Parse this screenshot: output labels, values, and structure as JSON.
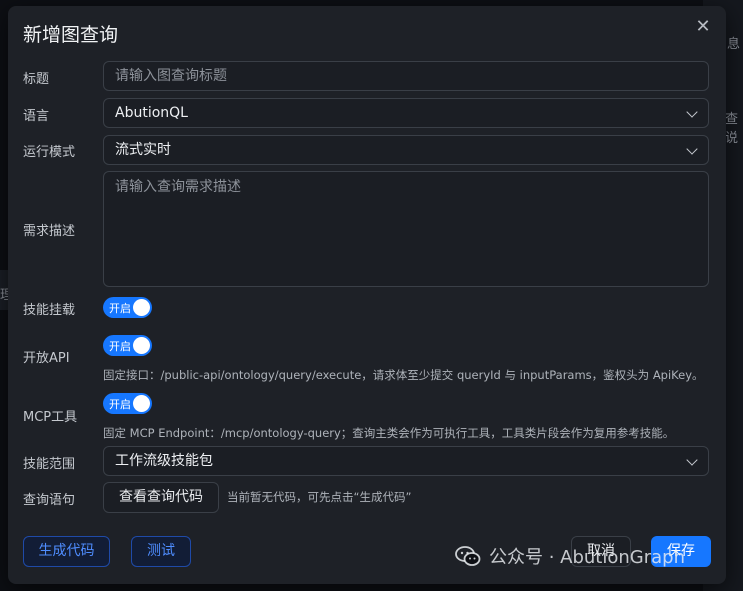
{
  "dialog": {
    "title": "新增图查询",
    "close_glyph": "✕"
  },
  "form": {
    "title_label": "标题",
    "title_placeholder": "请输入图查询标题",
    "language_label": "语言",
    "language_value": "AbutionQL",
    "mode_label": "运行模式",
    "mode_value": "流式实时",
    "desc_label": "需求描述",
    "desc_placeholder": "请输入查询需求描述",
    "skill_mount_label": "技能挂载",
    "skill_mount_toggle": "开启",
    "open_api_label": "开放API",
    "open_api_toggle": "开启",
    "open_api_hint": "固定接口：/public-api/ontology/query/execute，请求体至少提交 queryId 与 inputParams，鉴权头为 ApiKey。",
    "mcp_label": "MCP工具",
    "mcp_toggle": "开启",
    "mcp_hint": "固定 MCP Endpoint：/mcp/ontology-query；查询主类会作为可执行工具，工具类片段会作为复用参考技能。",
    "skill_scope_label": "技能范围",
    "skill_scope_value": "工作流级技能包",
    "query_label": "查询语句",
    "view_code_button": "查看查询代码",
    "query_hint": "当前暂无代码，可先点击“生成代码”"
  },
  "footer": {
    "generate_button": "生成代码",
    "test_button": "测试",
    "cancel_button": "取消",
    "save_button": "保存"
  },
  "background": {
    "right_text_1": "息",
    "right_text_2": "查说",
    "left_text": "理"
  },
  "watermark": {
    "text": "公众号 · AbutionGraph",
    "icon": "wechat-icon"
  },
  "colors": {
    "primary": "#1677ff",
    "dialog_bg": "#1e2127",
    "page_bg": "#0d0f14"
  }
}
